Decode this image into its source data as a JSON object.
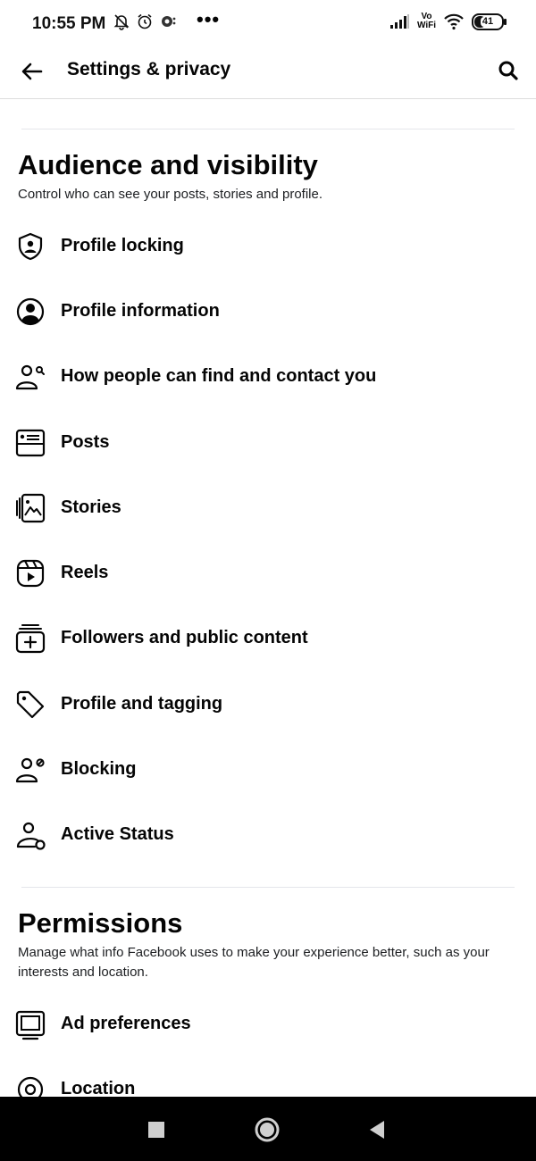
{
  "status_bar": {
    "time": "10:55 PM",
    "more": "•••",
    "vowifi_top": "Vo",
    "vowifi_bottom": "WiFi",
    "battery": "41",
    "battery_level": 0.41
  },
  "header": {
    "title": "Settings & privacy"
  },
  "audience": {
    "title": "Audience and visibility",
    "description": "Control who can see your posts, stories and profile.",
    "items": [
      {
        "label": "Profile locking",
        "icon": "shield-person-icon"
      },
      {
        "label": "Profile information",
        "icon": "profile-circle-icon"
      },
      {
        "label": "How people can find and contact you",
        "icon": "find-people-icon"
      },
      {
        "label": "Posts",
        "icon": "posts-icon"
      },
      {
        "label": "Stories",
        "icon": "stories-icon"
      },
      {
        "label": "Reels",
        "icon": "reels-icon"
      },
      {
        "label": "Followers and public content",
        "icon": "followers-icon"
      },
      {
        "label": "Profile and tagging",
        "icon": "tag-icon"
      },
      {
        "label": "Blocking",
        "icon": "blocking-icon"
      },
      {
        "label": "Active Status",
        "icon": "active-status-icon"
      }
    ]
  },
  "permissions": {
    "title": "Permissions",
    "description": "Manage what info Facebook uses to make your experience better, such as your interests and location.",
    "items": [
      {
        "label": "Ad preferences",
        "icon": "ad-preferences-icon"
      },
      {
        "label": "Location",
        "icon": "location-icon"
      }
    ]
  }
}
